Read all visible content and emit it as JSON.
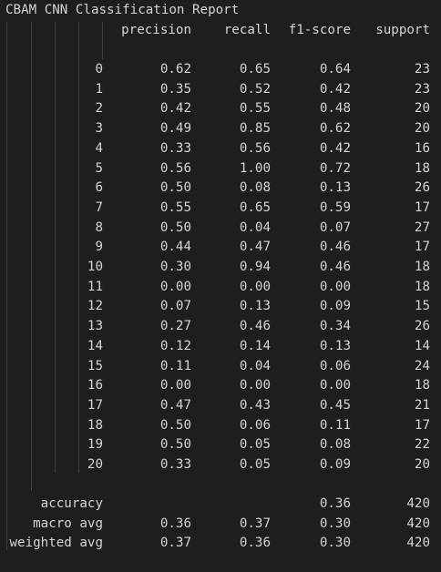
{
  "title": "CBAM CNN Classification Report",
  "headers": {
    "precision": "precision",
    "recall": "recall",
    "f1": "f1-score",
    "support": "support"
  },
  "rows": [
    {
      "label": "0",
      "precision": "0.62",
      "recall": "0.65",
      "f1": "0.64",
      "support": "23"
    },
    {
      "label": "1",
      "precision": "0.35",
      "recall": "0.52",
      "f1": "0.42",
      "support": "23"
    },
    {
      "label": "2",
      "precision": "0.42",
      "recall": "0.55",
      "f1": "0.48",
      "support": "20"
    },
    {
      "label": "3",
      "precision": "0.49",
      "recall": "0.85",
      "f1": "0.62",
      "support": "20"
    },
    {
      "label": "4",
      "precision": "0.33",
      "recall": "0.56",
      "f1": "0.42",
      "support": "16"
    },
    {
      "label": "5",
      "precision": "0.56",
      "recall": "1.00",
      "f1": "0.72",
      "support": "18"
    },
    {
      "label": "6",
      "precision": "0.50",
      "recall": "0.08",
      "f1": "0.13",
      "support": "26"
    },
    {
      "label": "7",
      "precision": "0.55",
      "recall": "0.65",
      "f1": "0.59",
      "support": "17"
    },
    {
      "label": "8",
      "precision": "0.50",
      "recall": "0.04",
      "f1": "0.07",
      "support": "27"
    },
    {
      "label": "9",
      "precision": "0.44",
      "recall": "0.47",
      "f1": "0.46",
      "support": "17"
    },
    {
      "label": "10",
      "precision": "0.30",
      "recall": "0.94",
      "f1": "0.46",
      "support": "18"
    },
    {
      "label": "11",
      "precision": "0.00",
      "recall": "0.00",
      "f1": "0.00",
      "support": "18"
    },
    {
      "label": "12",
      "precision": "0.07",
      "recall": "0.13",
      "f1": "0.09",
      "support": "15"
    },
    {
      "label": "13",
      "precision": "0.27",
      "recall": "0.46",
      "f1": "0.34",
      "support": "26"
    },
    {
      "label": "14",
      "precision": "0.12",
      "recall": "0.14",
      "f1": "0.13",
      "support": "14"
    },
    {
      "label": "15",
      "precision": "0.11",
      "recall": "0.04",
      "f1": "0.06",
      "support": "24"
    },
    {
      "label": "16",
      "precision": "0.00",
      "recall": "0.00",
      "f1": "0.00",
      "support": "18"
    },
    {
      "label": "17",
      "precision": "0.47",
      "recall": "0.43",
      "f1": "0.45",
      "support": "21"
    },
    {
      "label": "18",
      "precision": "0.50",
      "recall": "0.06",
      "f1": "0.11",
      "support": "17"
    },
    {
      "label": "19",
      "precision": "0.50",
      "recall": "0.05",
      "f1": "0.08",
      "support": "22"
    },
    {
      "label": "20",
      "precision": "0.33",
      "recall": "0.05",
      "f1": "0.09",
      "support": "20"
    }
  ],
  "summary": [
    {
      "label": "accuracy",
      "precision": "",
      "recall": "",
      "f1": "0.36",
      "support": "420"
    },
    {
      "label": "macro avg",
      "precision": "0.36",
      "recall": "0.37",
      "f1": "0.30",
      "support": "420"
    },
    {
      "label": "weighted avg",
      "precision": "0.37",
      "recall": "0.36",
      "f1": "0.30",
      "support": "420"
    }
  ]
}
